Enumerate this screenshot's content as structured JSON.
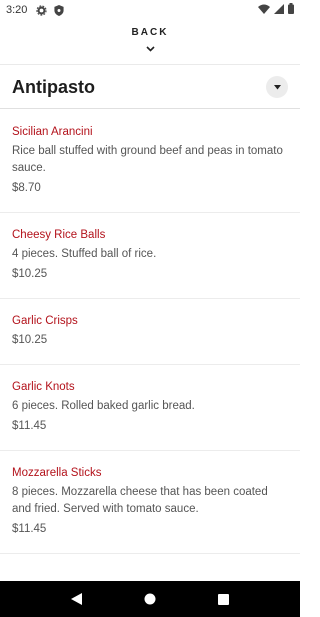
{
  "status_bar": {
    "time": "3:20",
    "icons": [
      "settings-icon",
      "shield-icon",
      "wifi-icon",
      "signal-icon",
      "battery-icon"
    ]
  },
  "header": {
    "back_label": "BACK",
    "chevron_icon": "chevron-down-icon"
  },
  "category": {
    "title": "Antipasto",
    "toggle_icon": "caret-down-icon"
  },
  "menu_items": [
    {
      "name": "Sicilian Arancini",
      "description": "Rice ball stuffed with ground beef and peas in tomato sauce.",
      "price": "$8.70"
    },
    {
      "name": "Cheesy Rice Balls",
      "description": "4 pieces. Stuffed ball of rice.",
      "price": "$10.25"
    },
    {
      "name": "Garlic Crisps",
      "description": "",
      "price": "$10.25"
    },
    {
      "name": "Garlic Knots",
      "description": "6 pieces. Rolled baked garlic bread.",
      "price": "$11.45"
    },
    {
      "name": "Mozzarella Sticks",
      "description": "8 pieces. Mozzarella cheese that has been coated and fried. Served with tomato sauce.",
      "price": "$11.45"
    }
  ],
  "nav_bar": {
    "icons": [
      "back-triangle-icon",
      "home-circle-icon",
      "recents-square-icon"
    ]
  },
  "colors": {
    "item_name": "#b3121b",
    "nav_bar": "#000000"
  }
}
